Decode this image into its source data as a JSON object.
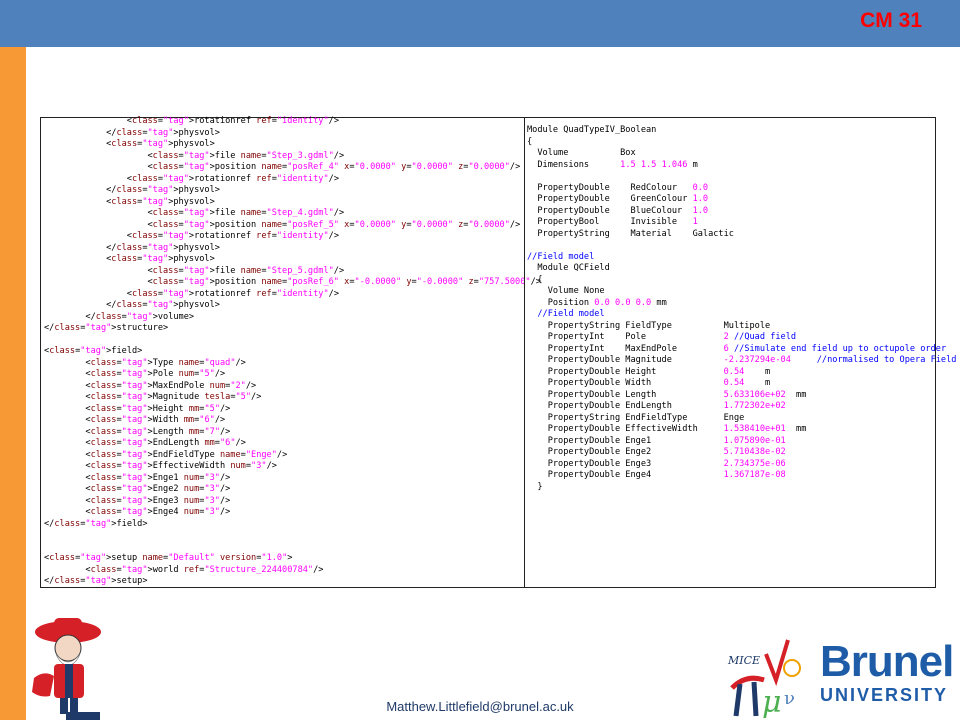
{
  "slide": {
    "number": "CM 31",
    "footer_email": "Matthew.Littlefield@brunel.ac.uk"
  },
  "colors": {
    "top_bar": "#4f81bd",
    "left_bar": "#f79a36",
    "slide_number": "#ff0000",
    "xml_tag": "#000080",
    "xml_attr": "#800000",
    "xml_value": "#ff00ff",
    "comment": "#0000ff"
  },
  "logos": {
    "left": "rebels-mascot-logo",
    "mice": "mice-logo",
    "mice_text": "MICE",
    "brunel_line1": "Brunel",
    "brunel_line2": "UNIVERSITY"
  },
  "xml_code": [
    "                <rotationref ref=\"identity\"/>",
    "            </physvol>",
    "            <physvol>",
    "                    <file name=\"Step_3.gdml\"/>",
    "                    <position name=\"posRef_4\" x=\"0.0000\" y=\"0.0000\" z=\"0.0000\"/>",
    "                <rotationref ref=\"identity\"/>",
    "            </physvol>",
    "            <physvol>",
    "                    <file name=\"Step_4.gdml\"/>",
    "                    <position name=\"posRef_5\" x=\"0.0000\" y=\"0.0000\" z=\"0.0000\"/>",
    "                <rotationref ref=\"identity\"/>",
    "            </physvol>",
    "            <physvol>",
    "                    <file name=\"Step_5.gdml\"/>",
    "                    <position name=\"posRef_6\" x=\"-0.0000\" y=\"-0.0000\" z=\"757.5000\"/>",
    "                <rotationref ref=\"identity\"/>",
    "            </physvol>",
    "        </volume>",
    "</structure>",
    "",
    "<field>",
    "        <Type name=\"quad\"/>",
    "        <Pole num=\"5\"/>",
    "        <MaxEndPole num=\"2\"/>",
    "        <Magnitude tesla=\"5\"/>",
    "        <Height mm=\"5\"/>",
    "        <Width mm=\"6\"/>",
    "        <Length mm=\"7\"/>",
    "        <EndLength mm=\"6\"/>",
    "        <EndFieldType name=\"Enge\"/>",
    "        <EffectiveWidth num=\"3\"/>",
    "        <Enge1 num=\"3\"/>",
    "        <Enge2 num=\"3\"/>",
    "        <Enge3 num=\"3\"/>",
    "        <Enge4 num=\"3\"/>",
    "</field>",
    "",
    "",
    "<setup name=\"Default\" version=\"1.0\">",
    "        <world ref=\"Structure_224400784\"/>",
    "</setup>"
  ],
  "module_code": [
    "Module QuadTypeIV_Boolean",
    "{",
    "  Volume          Box",
    "  Dimensions      1.5 1.5 1.046 m",
    "",
    "  PropertyDouble    RedColour   0.0",
    "  PropertyDouble    GreenColour 1.0",
    "  PropertyDouble    BlueColour  1.0",
    "  PropertyBool      Invisible   1",
    "  PropertyString    Material    Galactic",
    "",
    "//Field model",
    "  Module QCField",
    "  {",
    "    Volume None",
    "    Position 0.0 0.0 0.0 mm",
    "  //Field model",
    "    PropertyString FieldType          Multipole",
    "    PropertyInt    Pole               2 //Quad field",
    "    PropertyInt    MaxEndPole         6 //Simulate end field up to octupole order",
    "    PropertyDouble Magnitude          -2.237294e-04     //normalised to Opera Field map",
    "    PropertyDouble Height             0.54    m",
    "    PropertyDouble Width              0.54    m",
    "    PropertyDouble Length             5.633106e+02  mm",
    "    PropertyDouble EndLength          1.772302e+02",
    "    PropertyString EndFieldType       Enge",
    "    PropertyDouble EffectiveWidth     1.538410e+01  mm",
    "    PropertyDouble Enge1              1.075890e-01",
    "    PropertyDouble Enge2              5.710438e-02",
    "    PropertyDouble Enge3              2.734375e-06",
    "    PropertyDouble Enge4              1.367187e-08",
    "  }"
  ]
}
